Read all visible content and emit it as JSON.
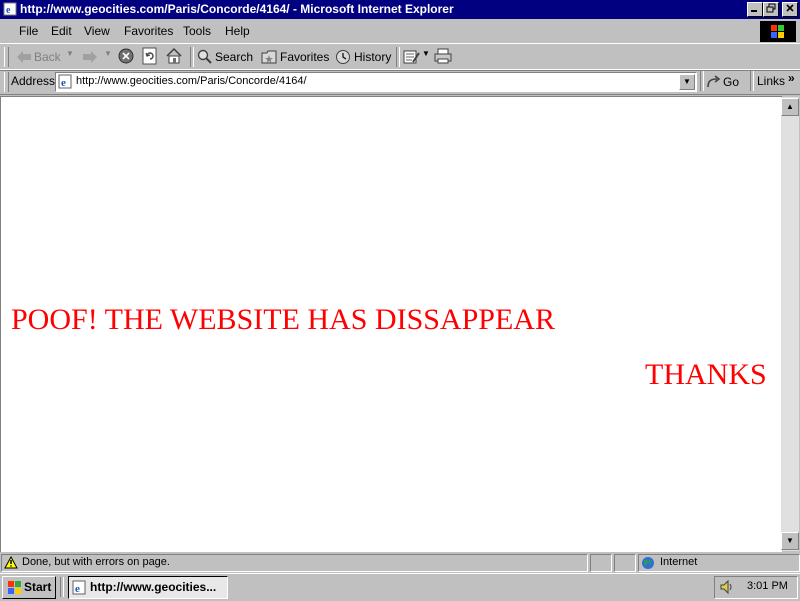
{
  "window": {
    "title": "http://www.geocities.com/Paris/Concorde/4164/ - Microsoft Internet Explorer",
    "minimize_icon": "minimize-icon",
    "maximize_icon": "restore-icon",
    "close_icon": "close-icon"
  },
  "menu": [
    "File",
    "Edit",
    "View",
    "Favorites",
    "Tools",
    "Help"
  ],
  "toolbar": {
    "back_label": "Back",
    "search_label": "Search",
    "favorites_label": "Favorites",
    "history_label": "History"
  },
  "address": {
    "label": "Address",
    "value": "http://www.geocities.com/Paris/Concorde/4164/",
    "go_label": "Go",
    "links_label": "Links",
    "links_chevron": "»"
  },
  "page": {
    "headline": "POOF! THE WEBSITE HAS DISSAPPEAR",
    "thanks": "THANKS",
    "text_color": "#ff0000"
  },
  "status": {
    "text": "Done, but with errors on page.",
    "zone": "Internet"
  },
  "taskbar": {
    "start_label": "Start",
    "task_label": "http://www.geocities...",
    "clock": "3:01 PM"
  }
}
